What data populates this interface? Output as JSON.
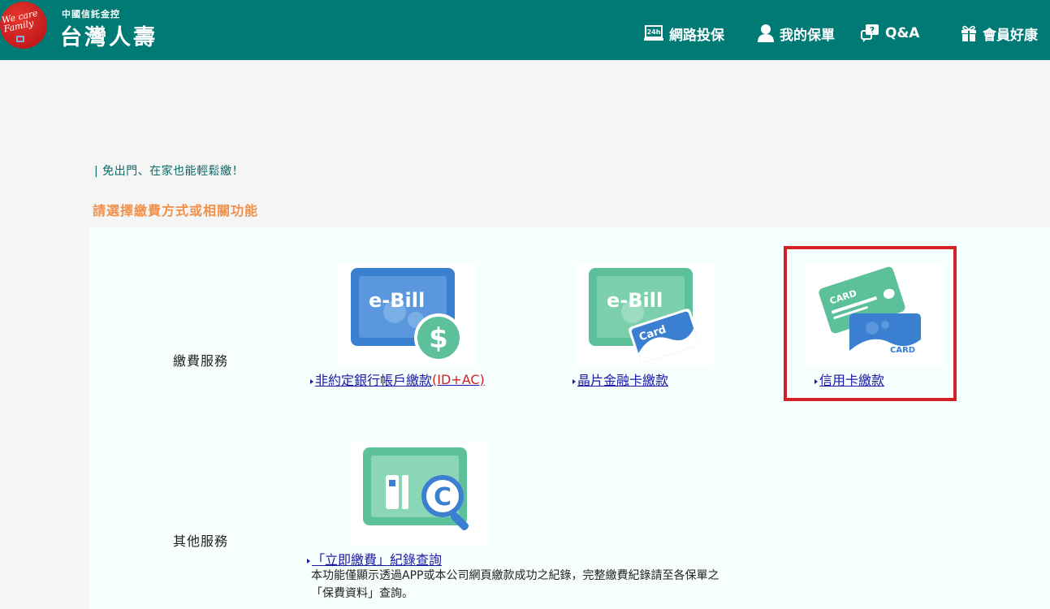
{
  "header": {
    "logo_text": "We care Family",
    "brand_sub": "中國信託金控",
    "brand_main": "台灣人壽",
    "nav": [
      {
        "label": "網路投保",
        "icon": "laptop-24h-icon"
      },
      {
        "label": "我的保單",
        "icon": "user-icon"
      },
      {
        "label": "Q&A",
        "icon": "question-bubble-icon"
      },
      {
        "label": "會員好康",
        "icon": "gift-icon"
      }
    ]
  },
  "intro": {
    "slogan": "| 免出門、在家也能輕鬆繳！",
    "instruction": "請選擇繳費方式或相關功能"
  },
  "payment": {
    "label": "繳費服務",
    "options": [
      {
        "link_main": "非約定銀行帳戶繳款",
        "link_extra": "(ID+AC)",
        "icon": "ebill-dollar-icon",
        "icon_text": "e-Bill"
      },
      {
        "link_main": "晶片金融卡繳款",
        "icon": "ebill-card-icon",
        "icon_text": "e-Bill",
        "card_text": "Card"
      },
      {
        "link_main": "信用卡繳款",
        "icon": "credit-card-icon",
        "card_text_1": "CARD",
        "card_text_2": "CARD"
      }
    ]
  },
  "other": {
    "label": "其他服務",
    "options": [
      {
        "link_main": "「立即繳費」紀錄查詢",
        "icon": "record-search-icon",
        "icon_text": "C"
      }
    ],
    "note": "本功能僅顯示透過APP或本公司網頁繳款成功之紀錄，完整繳費紀錄請至各保單之「保費資料」查詢。"
  },
  "colors": {
    "header_bg": "#007a74",
    "accent_orange": "#f0904a",
    "link_blue": "#1a1aa6",
    "highlight_red": "#d42027",
    "icon_blue": "#3a7fd0",
    "icon_green": "#5cc09a"
  }
}
